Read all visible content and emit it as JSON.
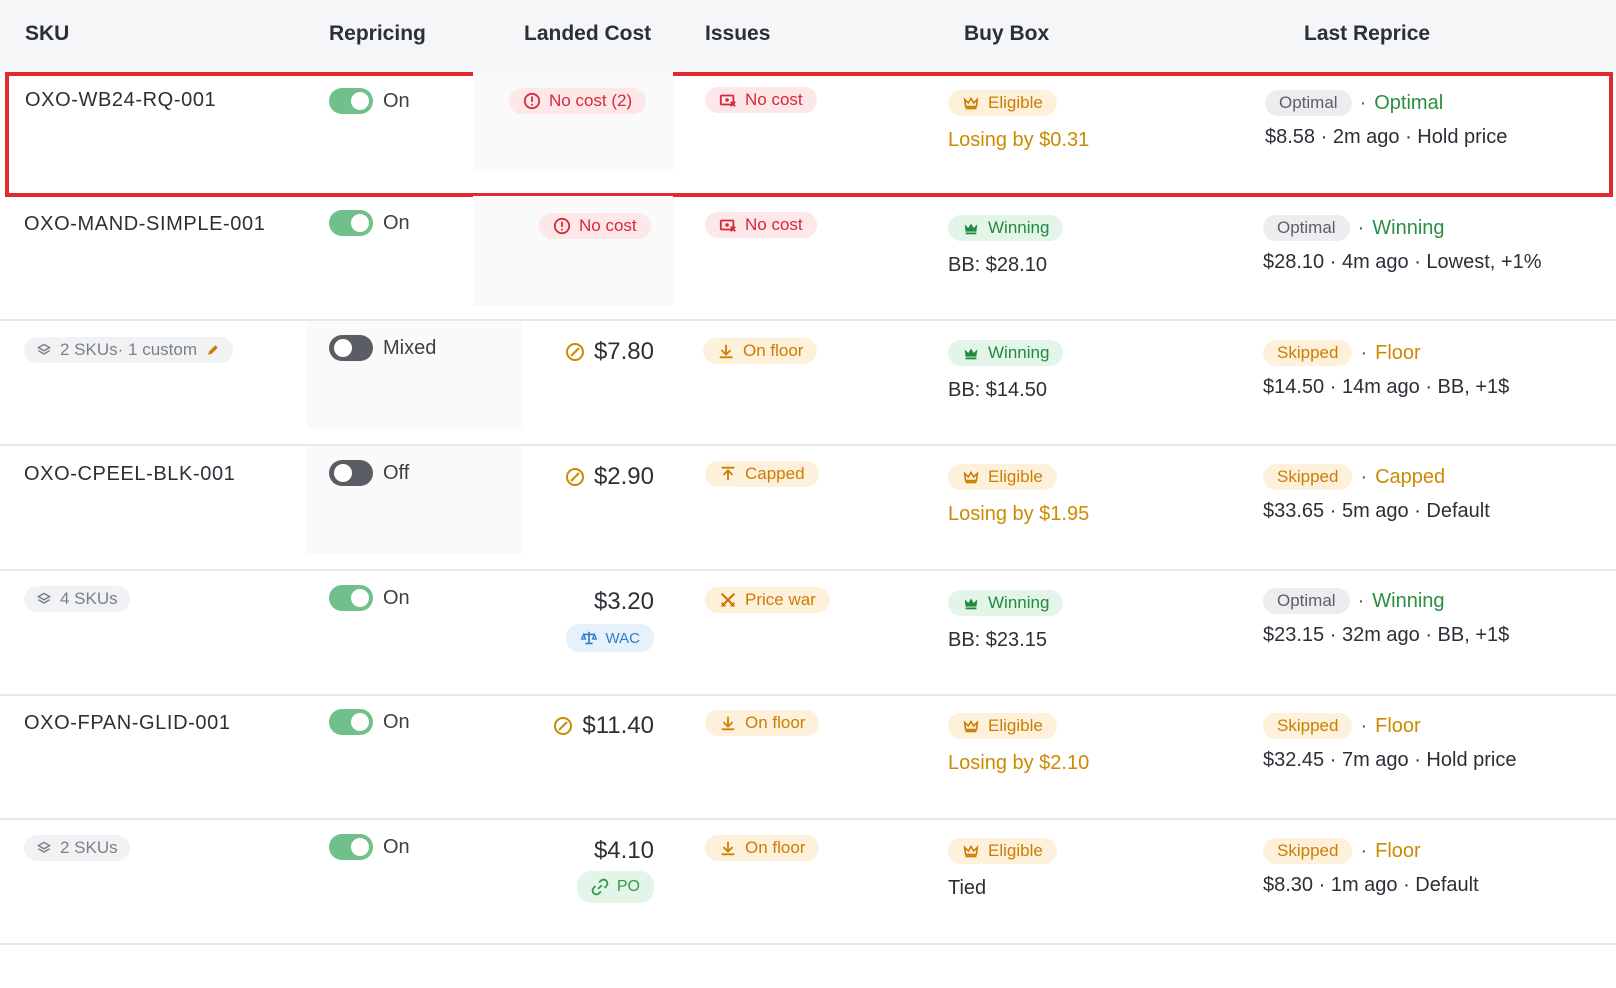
{
  "headers": {
    "sku": "SKU",
    "repricing": "Repricing",
    "landed_cost": "Landed Cost",
    "issues": "Issues",
    "buy_box": "Buy Box",
    "last_reprice": "Last Reprice"
  },
  "colors": {
    "selection_outline": "#e02b33",
    "toggle_on": "#6fc08a",
    "toggle_off": "#5a5d63",
    "danger": "#d6283a",
    "warning": "#cc7d00",
    "success": "#218a3e"
  },
  "rows": [
    {
      "sku": "OXO-WB24-RQ-001",
      "repricing": "On",
      "cost_pill": "No cost (2)",
      "issue": "No cost",
      "buybox_badge": "Eligible",
      "buybox_sub": "Losing by $0.31",
      "reprice_status": "Optimal",
      "reprice_outcome": "Optimal",
      "reprice_detail": "$8.58 · 2m ago · Hold price"
    },
    {
      "sku": "OXO-MAND-SIMPLE-001",
      "repricing": "On",
      "cost_pill": "No cost",
      "issue": "No cost",
      "buybox_badge": "Winning",
      "buybox_sub": "BB: $28.10",
      "reprice_status": "Optimal",
      "reprice_outcome": "Winning",
      "reprice_detail": "$28.10 · 4m ago · Lowest, +1%"
    },
    {
      "sku_group": "2 SKUs· 1 custom",
      "repricing": "Mixed",
      "cost": "$7.80",
      "issue": "On floor",
      "buybox_badge": "Winning",
      "buybox_sub": "BB: $14.50",
      "reprice_status": "Skipped",
      "reprice_outcome": "Floor",
      "reprice_detail": "$14.50 · 14m ago · BB, +1$"
    },
    {
      "sku": "OXO-CPEEL-BLK-001",
      "repricing": "Off",
      "cost": "$2.90",
      "issue": "Capped",
      "buybox_badge": "Eligible",
      "buybox_sub": "Losing by $1.95",
      "reprice_status": "Skipped",
      "reprice_outcome": "Capped",
      "reprice_detail": "$33.65 · 5m ago · Default"
    },
    {
      "sku_group": "4 SKUs",
      "repricing": "On",
      "cost": "$3.20",
      "cost_source": "WAC",
      "issue": "Price war",
      "buybox_badge": "Winning",
      "buybox_sub": "BB: $23.15",
      "reprice_status": "Optimal",
      "reprice_outcome": "Winning",
      "reprice_detail": "$23.15 · 32m ago · BB, +1$"
    },
    {
      "sku": "OXO-FPAN-GLID-001",
      "repricing": "On",
      "cost": "$11.40",
      "issue": "On floor",
      "buybox_badge": "Eligible",
      "buybox_sub": "Losing by $2.10",
      "reprice_status": "Skipped",
      "reprice_outcome": "Floor",
      "reprice_detail": "$32.45 · 7m ago · Hold price"
    },
    {
      "sku_group": "2 SKUs",
      "repricing": "On",
      "cost": "$4.10",
      "cost_source": "PO",
      "issue": "On floor",
      "buybox_badge": "Eligible",
      "buybox_sub": "Tied",
      "reprice_status": "Skipped",
      "reprice_outcome": "Floor",
      "reprice_detail": "$8.30 · 1m ago · Default"
    }
  ]
}
